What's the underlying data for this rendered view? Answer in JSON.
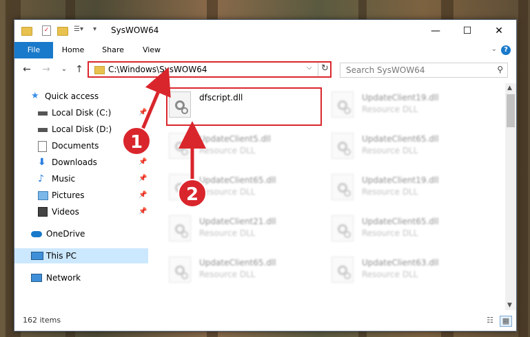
{
  "window": {
    "title": "SysWOW64",
    "controls": {
      "minimize": "—",
      "maximize": "☐",
      "close": "✕"
    }
  },
  "ribbon": {
    "tabs": [
      "File",
      "Home",
      "Share",
      "View"
    ],
    "help": "?",
    "collapse": "⌄"
  },
  "address_bar": {
    "path": "C:\\Windows\\SysWOW64",
    "dropdown": "⌵",
    "refresh": "↻"
  },
  "search": {
    "placeholder": "Search SysWOW64",
    "icon": "search-icon"
  },
  "navigation": {
    "back": "←",
    "forward": "→",
    "recent": "⌄",
    "up": "↑",
    "items": [
      {
        "label": "Quick access",
        "icon": "star-icon"
      },
      {
        "label": "Local Disk (C:)",
        "icon": "drive-icon",
        "pinned": true
      },
      {
        "label": "Local Disk (D:)",
        "icon": "drive-icon"
      },
      {
        "label": "Documents",
        "icon": "documents-icon"
      },
      {
        "label": "Downloads",
        "icon": "download-icon",
        "pinned": true
      },
      {
        "label": "Music",
        "icon": "music-icon",
        "pinned": true
      },
      {
        "label": "Pictures",
        "icon": "pictures-icon",
        "pinned": true
      },
      {
        "label": "Videos",
        "icon": "videos-icon",
        "pinned": true
      },
      {
        "label": "OneDrive",
        "icon": "cloud-icon"
      },
      {
        "label": "This PC",
        "icon": "computer-icon",
        "selected": true
      },
      {
        "label": "Network",
        "icon": "network-icon"
      }
    ]
  },
  "files": [
    {
      "name": "dfscript.dll",
      "type": "",
      "highlighted": true
    },
    {
      "name": "UpdateClient19.dll",
      "type": "Resource DLL"
    },
    {
      "name": "UpdateClient5.dll",
      "type": "Resource DLL"
    },
    {
      "name": "UpdateClient65.dll",
      "type": "Resource DLL"
    },
    {
      "name": "UpdateClient65.dll",
      "type": "Resource DLL"
    },
    {
      "name": "UpdateClient19.dll",
      "type": "Resource DLL"
    },
    {
      "name": "UpdateClient21.dll",
      "type": "Resource DLL"
    },
    {
      "name": "UpdateClient65.dll",
      "type": "Resource DLL"
    },
    {
      "name": "UpdateClient65.dll",
      "type": "Resource DLL"
    },
    {
      "name": "UpdateClient63.dll",
      "type": "Resource DLL"
    }
  ],
  "status": {
    "item_count": "162 items"
  },
  "annotations": {
    "step1": "1",
    "step2": "2"
  },
  "colors": {
    "accent": "#1979ca",
    "annotation_red": "#d9262c",
    "selected_bg": "#cce8ff"
  }
}
